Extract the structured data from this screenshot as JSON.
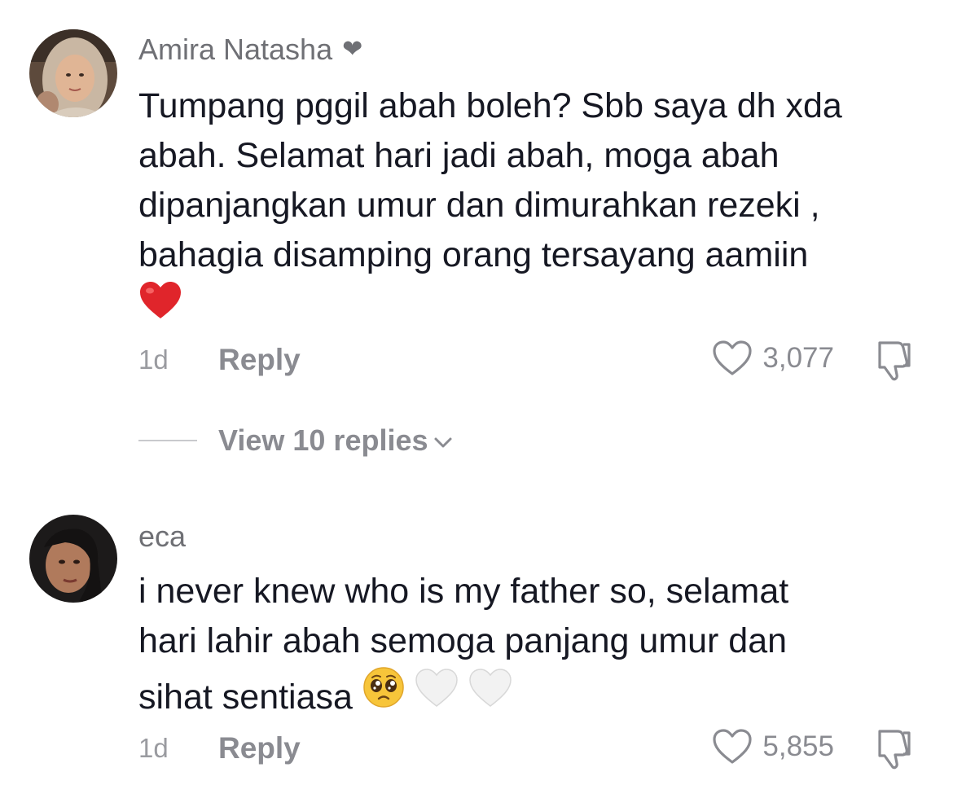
{
  "comments": [
    {
      "username": "Amira Natasha",
      "badge_icon": "heart-icon",
      "text_lines": [
        "Tumpang pggil abah boleh? Sbb saya dh xda",
        "abah. Selamat hari jadi abah, moga abah",
        "dipanjangkan umur dan dimurahkan rezeki ,",
        "bahagia disamping orang tersayang aamiin"
      ],
      "emojis": [
        "red-heart"
      ],
      "time": "1d",
      "reply_label": "Reply",
      "like_count": "3,077",
      "view_replies": "View 10 replies"
    },
    {
      "username": "eca",
      "text_lines": [
        "i never knew who is my father so, selamat",
        "hari lahir abah semoga panjang umur dan",
        "sihat sentiasa"
      ],
      "emojis": [
        "pleading-face",
        "white-heart",
        "white-heart"
      ],
      "time": "1d",
      "reply_label": "Reply",
      "like_count": "5,855"
    }
  ],
  "colors": {
    "text": "#161823",
    "muted": "#8a8b91",
    "heart_red": "#e0252b"
  }
}
